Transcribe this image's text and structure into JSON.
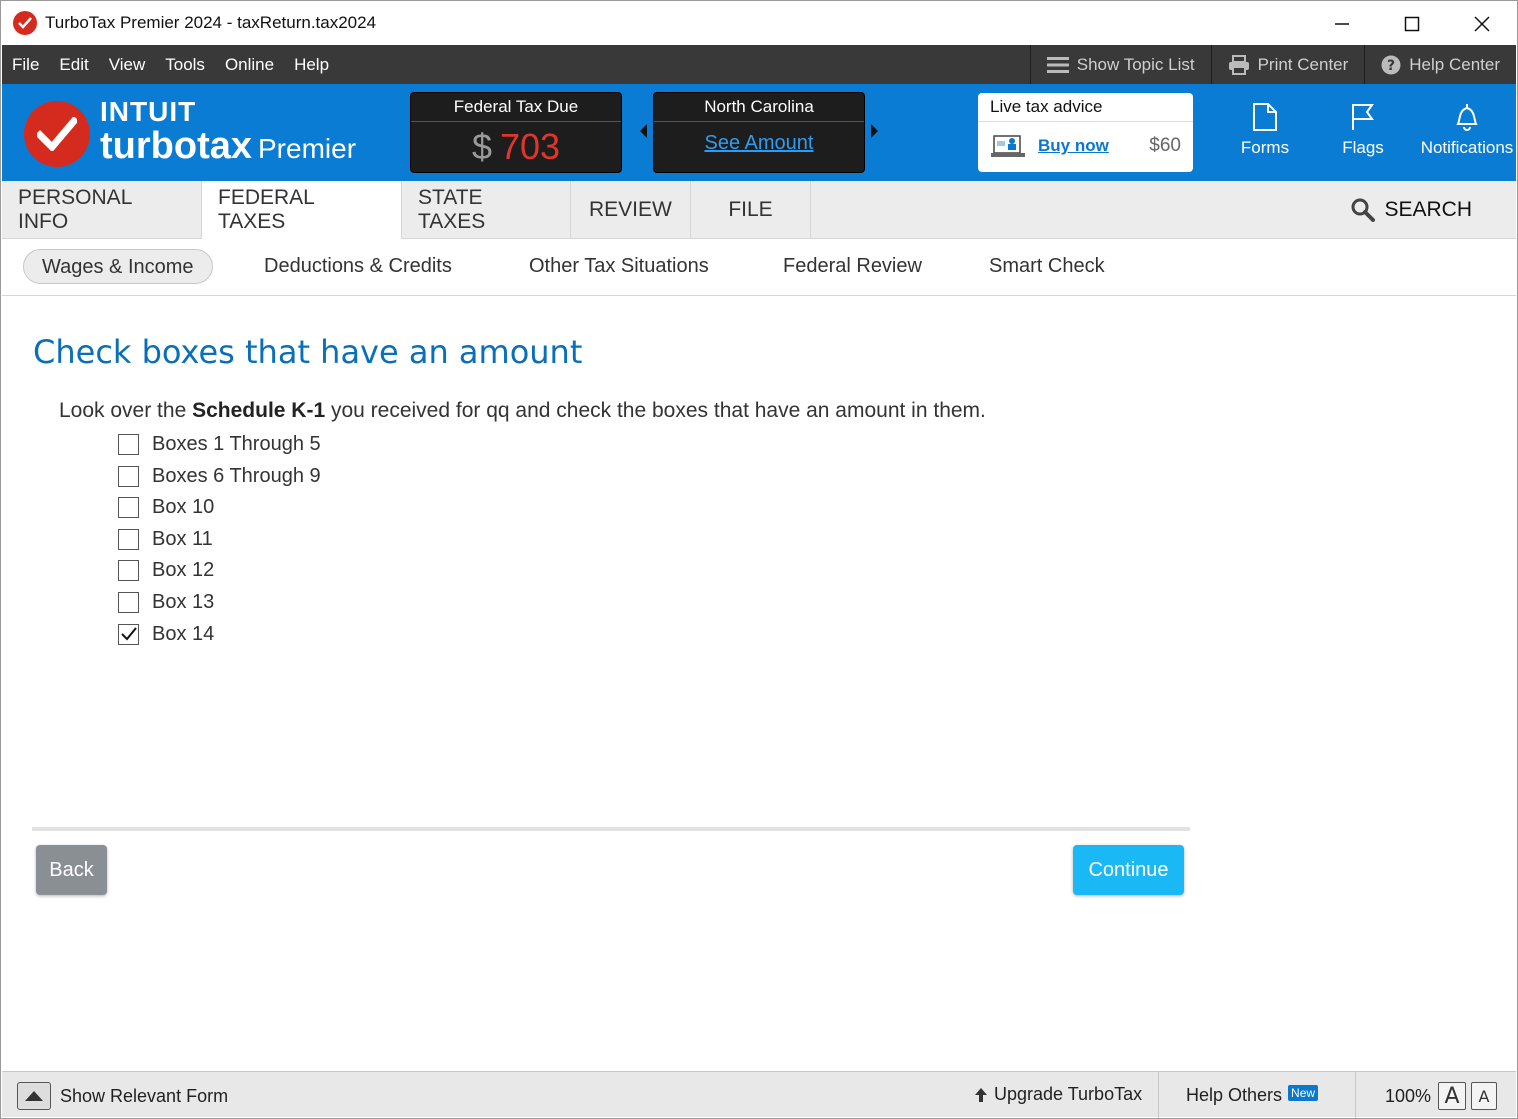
{
  "window": {
    "title": "TurboTax Premier 2024 - taxReturn.tax2024"
  },
  "menu": {
    "items": [
      "File",
      "Edit",
      "View",
      "Tools",
      "Online",
      "Help"
    ],
    "show_topic_list": "Show Topic List",
    "print_center": "Print Center",
    "help_center": "Help Center"
  },
  "header": {
    "logo_intuit": "INTUIT",
    "logo_turbotax": "turbotax",
    "logo_edition": "Premier",
    "federal_label": "Federal Tax Due",
    "federal_currency": "$",
    "federal_amount": "703",
    "state_label": "North Carolina",
    "state_link": "See Amount",
    "advice_label": "Live tax advice",
    "advice_buy": "Buy now",
    "advice_price": "$60",
    "forms": "Forms",
    "flags": "Flags",
    "notifications": "Notifications"
  },
  "tabs": {
    "items": [
      "PERSONAL INFO",
      "FEDERAL TAXES",
      "STATE TAXES",
      "REVIEW",
      "FILE"
    ],
    "active": "FEDERAL TAXES",
    "search": "SEARCH"
  },
  "subnav": {
    "items": [
      "Wages & Income",
      "Deductions & Credits",
      "Other Tax Situations",
      "Federal Review",
      "Smart Check"
    ],
    "active": "Wages & Income"
  },
  "page": {
    "heading": "Check boxes that have an amount",
    "intro_before": "Look over the ",
    "intro_bold": "Schedule K-1",
    "intro_after": " you received for qq and check the boxes that have an amount in them.",
    "options": [
      {
        "label": "Boxes 1 Through 5",
        "checked": false
      },
      {
        "label": "Boxes 6 Through 9",
        "checked": false
      },
      {
        "label": "Box 10",
        "checked": false
      },
      {
        "label": "Box 11",
        "checked": false
      },
      {
        "label": "Box 12",
        "checked": false
      },
      {
        "label": "Box 13",
        "checked": false
      },
      {
        "label": "Box 14",
        "checked": true
      }
    ],
    "back": "Back",
    "continue": "Continue"
  },
  "status": {
    "show_relevant_form": "Show Relevant Form",
    "upgrade": "Upgrade TurboTax",
    "help_others": "Help Others",
    "new_badge": "New",
    "zoom": "100%",
    "font_large": "A",
    "font_small": "A"
  },
  "colors": {
    "brand_blue": "#0b7cd3",
    "heading_blue": "#0a6fb8",
    "tax_due_red": "#e0362a",
    "continue_button": "#1ab8f5",
    "back_button": "#8a8f94"
  }
}
